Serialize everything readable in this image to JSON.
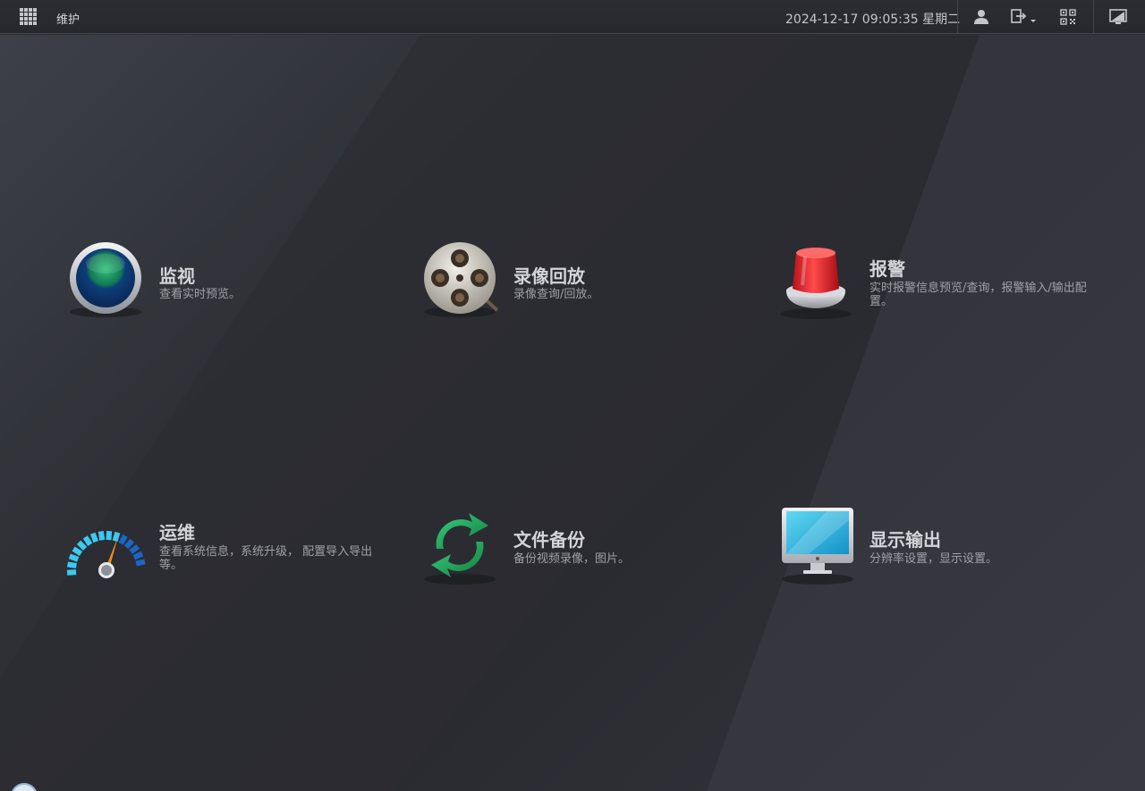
{
  "header": {
    "breadcrumb": "维护",
    "datetime": "2024-12-17 09:05:35 星期二",
    "icons": [
      "apps-grid-icon",
      "user-icon",
      "logout-icon",
      "qr-code-icon",
      "display-icon"
    ]
  },
  "tiles": [
    {
      "title": "监视",
      "desc": "查看实时预览。",
      "icon": "monitor-lens-icon"
    },
    {
      "title": "录像回放",
      "desc": "录像查询/回放。",
      "icon": "film-reel-icon"
    },
    {
      "title": "报警",
      "desc": "实时报警信息预览/查询，报警输入/输出配置。",
      "icon": "alarm-siren-icon"
    },
    {
      "title": "运维",
      "desc": "查看系统信息，系统升级， 配置导入导出等。",
      "icon": "gauge-icon"
    },
    {
      "title": "文件备份",
      "desc": "备份视频录像，图片。",
      "icon": "sync-arrows-icon"
    },
    {
      "title": "显示输出",
      "desc": "分辨率设置，显示设置。",
      "icon": "computer-monitor-icon"
    }
  ],
  "colors": {
    "topbar": "#2b2d33",
    "text_primary": "#d2d4d8",
    "text_secondary": "#9ea1a7",
    "accent_green": "#2fbf6a",
    "accent_red": "#e52a2a",
    "accent_blue": "#2aa8e8"
  }
}
